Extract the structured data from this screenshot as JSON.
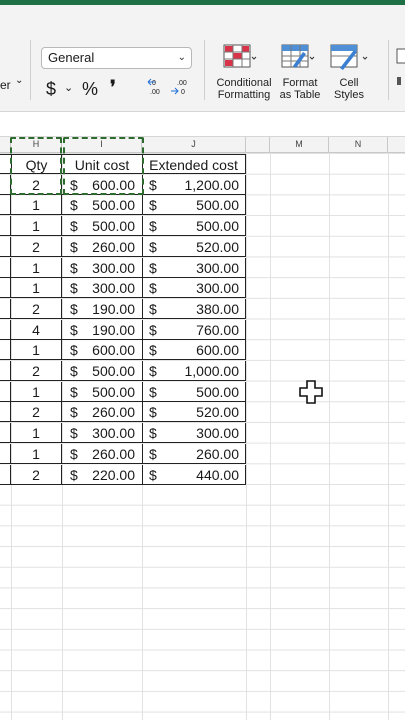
{
  "ribbon": {
    "number_format": "General",
    "partial_label": "er",
    "currency_symbol": "$",
    "percent_symbol": "%",
    "comma_symbol": "❜",
    "conditional_formatting": [
      "Conditional",
      "Formatting"
    ],
    "format_as_table": [
      "Format",
      "as Table"
    ],
    "cell_styles": [
      "Cell",
      "Styles"
    ]
  },
  "columns": [
    "H",
    "I",
    "J",
    "M",
    "N"
  ],
  "headers": {
    "qty": "Qty",
    "unit_cost": "Unit cost",
    "extended_cost": "Extended cost"
  },
  "rows": [
    {
      "qty": "2",
      "unit": "600.00",
      "ext": "1,200.00"
    },
    {
      "qty": "1",
      "unit": "500.00",
      "ext": "500.00"
    },
    {
      "qty": "1",
      "unit": "500.00",
      "ext": "500.00"
    },
    {
      "qty": "2",
      "unit": "260.00",
      "ext": "520.00"
    },
    {
      "qty": "1",
      "unit": "300.00",
      "ext": "300.00"
    },
    {
      "qty": "1",
      "unit": "300.00",
      "ext": "300.00"
    },
    {
      "qty": "2",
      "unit": "190.00",
      "ext": "380.00"
    },
    {
      "qty": "4",
      "unit": "190.00",
      "ext": "760.00"
    },
    {
      "qty": "1",
      "unit": "600.00",
      "ext": "600.00"
    },
    {
      "qty": "2",
      "unit": "500.00",
      "ext": "1,000.00"
    },
    {
      "qty": "1",
      "unit": "500.00",
      "ext": "500.00"
    },
    {
      "qty": "2",
      "unit": "260.00",
      "ext": "520.00"
    },
    {
      "qty": "1",
      "unit": "300.00",
      "ext": "300.00"
    },
    {
      "qty": "1",
      "unit": "260.00",
      "ext": "260.00"
    },
    {
      "qty": "2",
      "unit": "220.00",
      "ext": "440.00"
    }
  ],
  "dollar": "$",
  "colors": {
    "accent": "#1f7145",
    "copy_marquee": "#2e6b2e"
  }
}
